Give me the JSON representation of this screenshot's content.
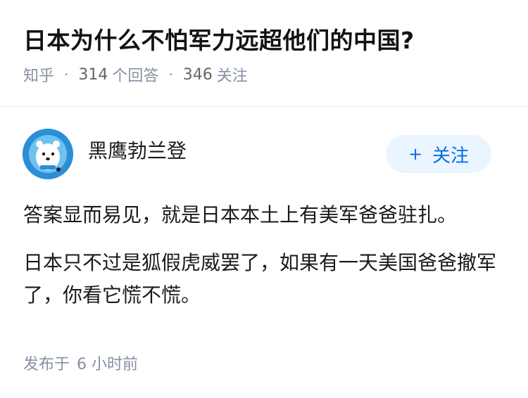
{
  "question": {
    "title": "日本为什么不怕军力远超他们的中国?",
    "source": "知乎",
    "answer_count": "314",
    "answer_label": "个回答",
    "follower_count": "346",
    "follower_label": "关注"
  },
  "answer": {
    "author_name": "黑鹰勃兰登",
    "follow_button": {
      "icon": "plus-icon",
      "label": "关注"
    },
    "paragraphs": [
      "答案显而易见，就是日本本土上有美军爸爸驻扎。",
      "日本只不过是狐假虎威罢了，如果有一天美国爸爸撤军了，你看它慌不慌。"
    ],
    "published_prefix": "发布于",
    "published_time": "6 小时前"
  },
  "colors": {
    "accent": "#056de8",
    "button_bg": "#ebf5ff",
    "meta_text": "#8590a6",
    "avatar_bg": "#2b8fd6"
  }
}
